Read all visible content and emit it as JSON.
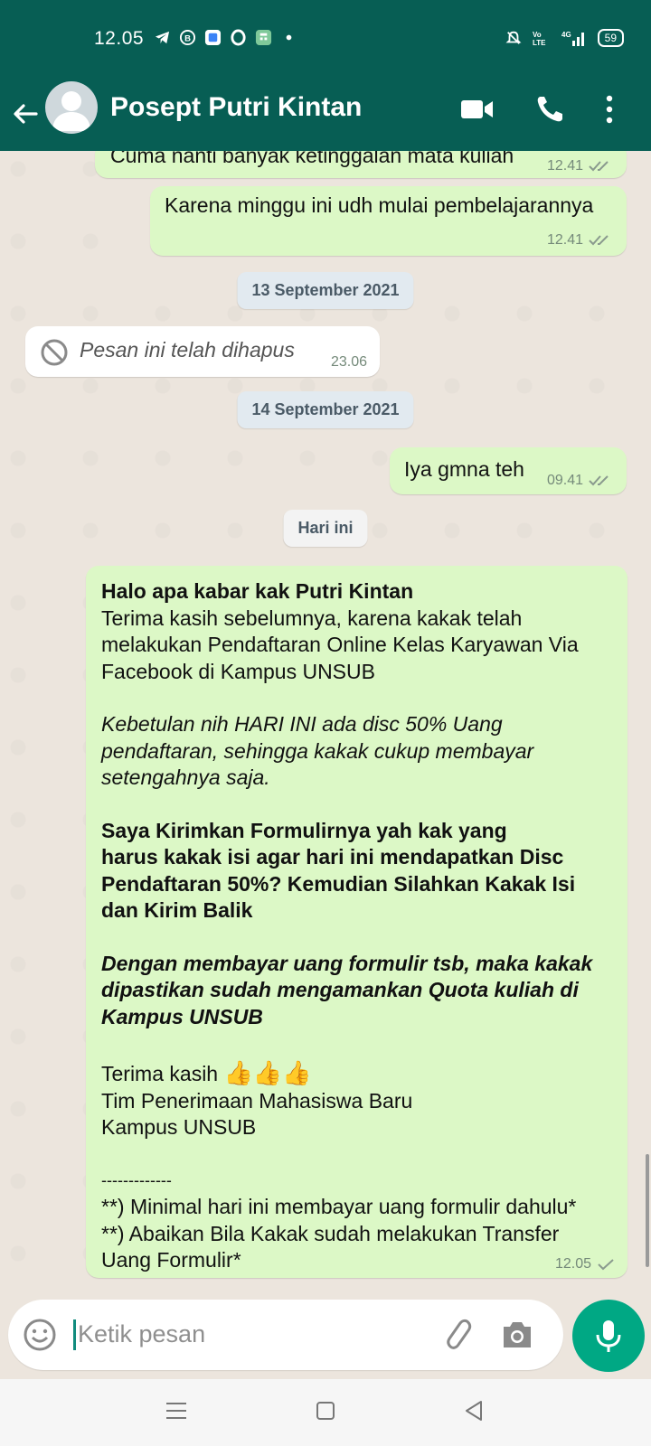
{
  "status_bar": {
    "time": "12.05",
    "battery": "59",
    "network": "4G"
  },
  "header": {
    "contact_name": "Posept Putri Kintan"
  },
  "messages": [
    {
      "text": "Cuma nanti banyak ketinggalan mata kuliah",
      "time": "12.41",
      "direction": "out"
    },
    {
      "text": "Karena minggu ini udh mulai pembelajarannya",
      "time": "12.41",
      "direction": "out"
    },
    {
      "date": "13 September 2021"
    },
    {
      "text": "Pesan ini telah dihapus",
      "time": "23.06",
      "direction": "in",
      "deleted": true
    },
    {
      "date": "14 September 2021"
    },
    {
      "text": "Iya gmna teh",
      "time": "09.41",
      "direction": "out"
    },
    {
      "date": "Hari ini"
    }
  ],
  "long_message": {
    "time": "12.05",
    "p1_bold": "Halo apa kabar kak Putri Kintan",
    "p1_rest": "Terima kasih sebelumnya, karena kakak telah melakukan Pendaftaran Online Kelas Karyawan Via Facebook di Kampus UNSUB",
    "p2_italic": "Kebetulan nih HARI INI ada disc 50% Uang pendaftaran, sehingga kakak cukup membayar setengahnya saja.",
    "p3_bold_line1": "Saya Kirimkan Formulirnya yah kak yang",
    "p3_bold_rest": "harus kakak isi agar hari ini mendapatkan Disc Pendaftaran 50%? Kemudian Silahkan Kakak Isi dan Kirim Balik",
    "p4_bolditalic": "Dengan membayar uang formulir tsb, maka kakak dipastikan sudah mengamankan Quota kuliah di Kampus UNSUB",
    "thanks": "Terima kasih",
    "thumbs": "👍👍👍",
    "signature_1": "Tim Penerimaan Mahasiswa Baru",
    "signature_2": "Kampus UNSUB",
    "divider": "-------------",
    "note_1": "**) Minimal hari ini membayar uang formulir dahulu*",
    "note_2": "**) Abaikan Bila Kakak sudah melakukan Transfer Uang Formulir*"
  },
  "input": {
    "placeholder": "Ketik pesan"
  },
  "colors": {
    "header": "#075e54",
    "outgoing_bubble": "#dcf8c6",
    "accent": "#00a884",
    "chat_bg": "#ece5dd"
  }
}
